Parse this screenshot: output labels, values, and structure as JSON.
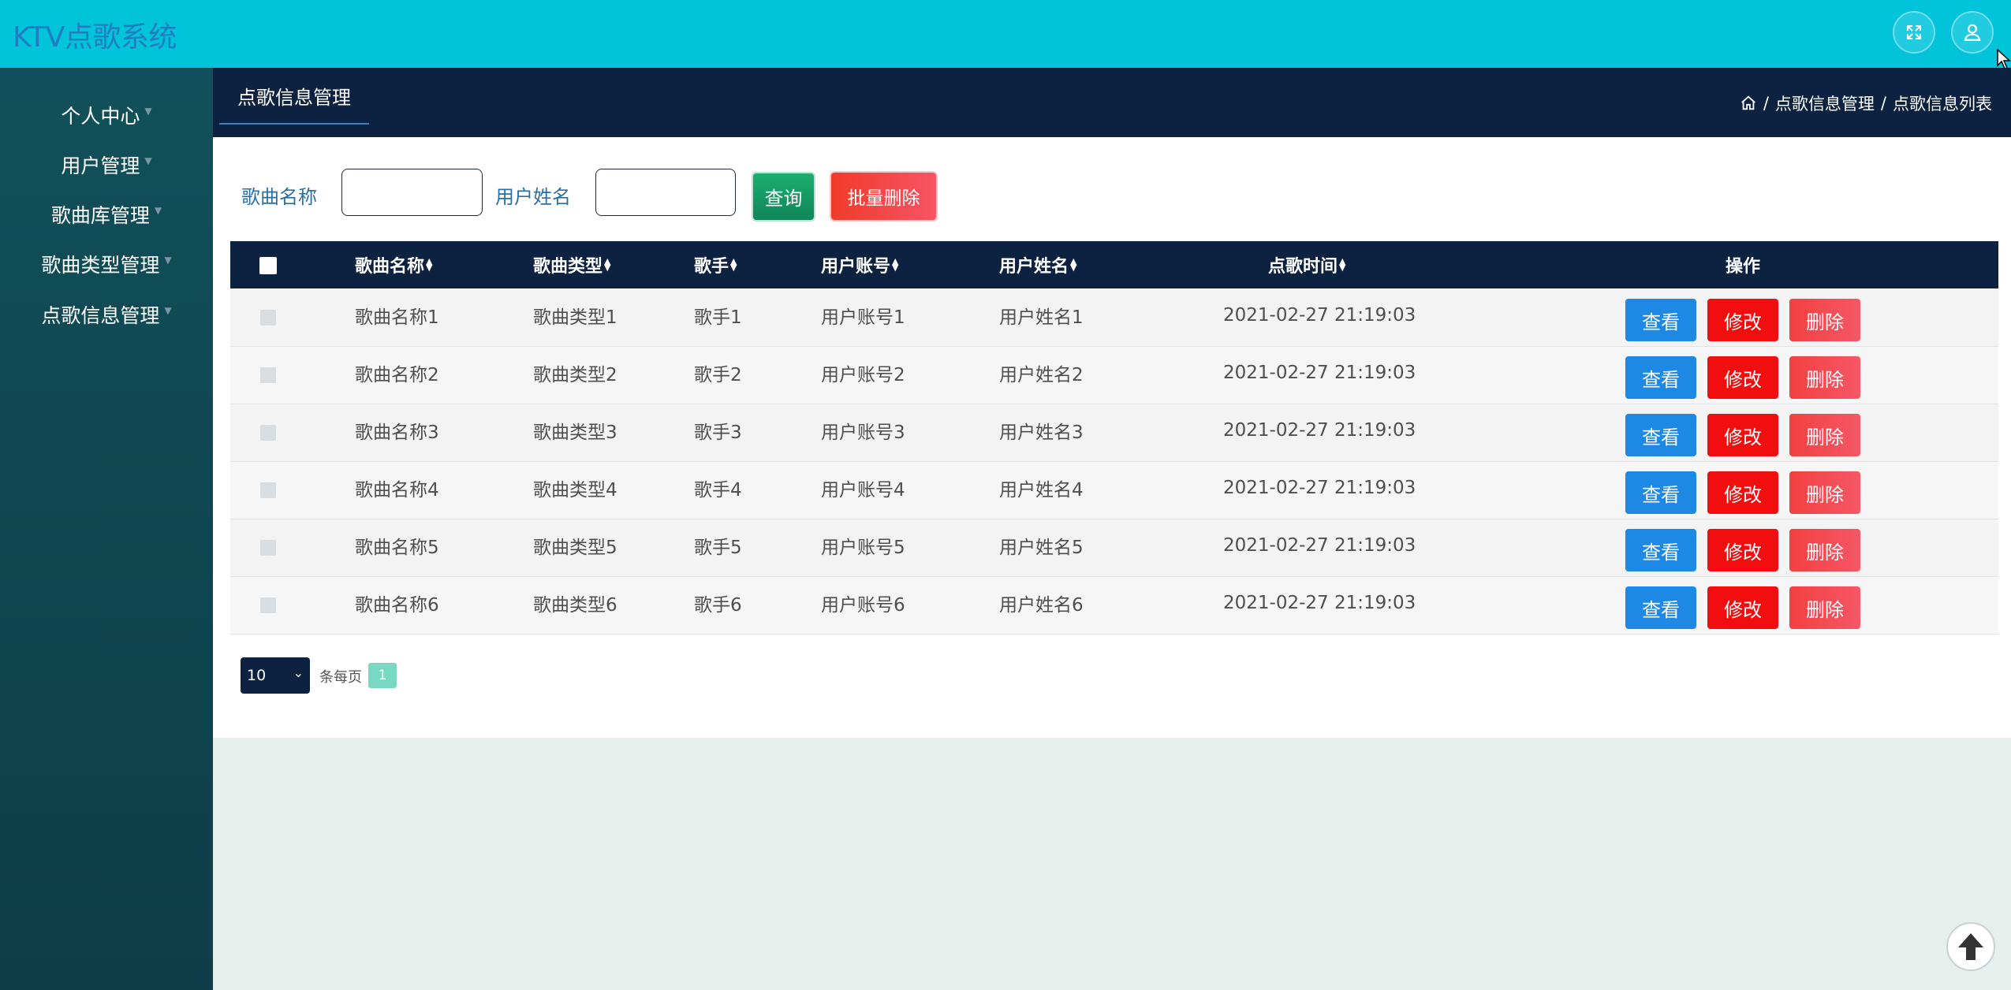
{
  "app": {
    "title": "KTV点歌系统"
  },
  "sidebar": {
    "items": [
      {
        "label": "个人中心"
      },
      {
        "label": "用户管理"
      },
      {
        "label": "歌曲库管理"
      },
      {
        "label": "歌曲类型管理"
      },
      {
        "label": "点歌信息管理"
      }
    ]
  },
  "header": {
    "tab": "点歌信息管理",
    "breadcrumb": [
      "点歌信息管理",
      "点歌信息列表"
    ],
    "breadcrumb_sep": "/"
  },
  "search": {
    "song_label": "歌曲名称",
    "user_label": "用户姓名",
    "song_value": "",
    "user_value": "",
    "query_button": "查询",
    "batch_delete_button": "批量删除"
  },
  "table": {
    "columns": [
      "歌曲名称",
      "歌曲类型",
      "歌手",
      "用户账号",
      "用户姓名",
      "点歌时间",
      "操作"
    ],
    "rows": [
      [
        "歌曲名称1",
        "歌曲类型1",
        "歌手1",
        "用户账号1",
        "用户姓名1",
        "2021-02-27 21:19:03"
      ],
      [
        "歌曲名称2",
        "歌曲类型2",
        "歌手2",
        "用户账号2",
        "用户姓名2",
        "2021-02-27 21:19:03"
      ],
      [
        "歌曲名称3",
        "歌曲类型3",
        "歌手3",
        "用户账号3",
        "用户姓名3",
        "2021-02-27 21:19:03"
      ],
      [
        "歌曲名称4",
        "歌曲类型4",
        "歌手4",
        "用户账号4",
        "用户姓名4",
        "2021-02-27 21:19:03"
      ],
      [
        "歌曲名称5",
        "歌曲类型5",
        "歌手5",
        "用户账号5",
        "用户姓名5",
        "2021-02-27 21:19:03"
      ],
      [
        "歌曲名称6",
        "歌曲类型6",
        "歌手6",
        "用户账号6",
        "用户姓名6",
        "2021-02-27 21:19:03"
      ]
    ],
    "actions": {
      "view": "查看",
      "edit": "修改",
      "delete": "删除"
    }
  },
  "pagination": {
    "page_size": "10",
    "per_page_label": "条每页",
    "current_page": "1"
  },
  "icons": {
    "fullscreen": "fullscreen-icon",
    "user": "user-icon",
    "home": "home-icon",
    "back_to_top": "arrow-up-icon"
  },
  "colors": {
    "topbar": "#01c3d9",
    "navy": "#0d2240",
    "sidebar": "#11505a",
    "view": "#1e88e5",
    "edit": "#f20e0e",
    "delete": "#f65767",
    "query": "#1cae71"
  }
}
